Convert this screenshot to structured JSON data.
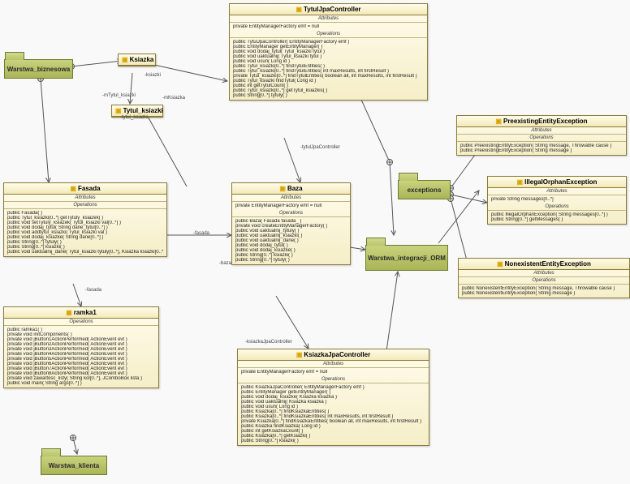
{
  "packages": {
    "warstwa_biznesowa": "Warstwa_biznesowa",
    "exceptions": "exceptions",
    "warstwa_integracji_orm": "Warstwa_integracji_ORM",
    "warstwa_klienta": "Warstwa_klienta"
  },
  "classes": {
    "ksiazka": {
      "title": "Ksiazka"
    },
    "tytul_ksiazki": {
      "title": "Tytul_ksiazki"
    },
    "tytuljpa": {
      "title": "TytulJpaController",
      "attrs_label": "Attributes",
      "attr1": "private EntityManagerFactory emf = null",
      "ops_label": "Operations",
      "ops": [
        "public TytulJpaController( EntityManagerFactory emf )",
        "public EntityManager getEntityManager( )",
        "public void dodaj_tytul( Tytul_ksiazki tytul )",
        "public void uaktualnij( Tytul_ksiazki tytul )",
        "public void usun( Long id )",
        "public Tytul_ksiazki[0..*] findTytulEntities( )",
        "public Tytul_ksiazki[0..*] findTytulEntities( int maxResults, int firstResult )",
        "private Tytul_ksiazki[0..*] findTytulEntities( boolean all, int maxResults, int firstResult )",
        "public Tytul_ksiazki findTytul( Long id )",
        "public int getTytulCount( )",
        "public Tytul_ksiazki[0..*] getTytul_ksiazkis( )",
        "public String[0..*] tytuly( )"
      ]
    },
    "fasada": {
      "title": "Fasada",
      "attrs_label": "Attributes",
      "ops_label": "Operations",
      "ops": [
        "public Fasada( )",
        "public Tytul_ksiazki[0..*] getTytuly_ksiazek( )",
        "public void setTytuly_ksiazek( Tytul_ksiazki val[0..*] )",
        "public void dodaj_tytul( String dane_tytul[0..*] )",
        "public void addtytul_ksiazki( Tytul_ksiazki val )",
        "public void dodaj_ksiazke( String dane[0..*] )",
        "public String[0..*] tytuly( )",
        "public String[0..*] ksiazki( )",
        "public void uaktualnij_dane( Tytul_ksiazki tytuly[0..*], Ksiazka ksiazki[0..*] )"
      ]
    },
    "baza": {
      "title": "Baza",
      "attrs_label": "Attributes",
      "attr1": "private EntityManagerFactory emf = null",
      "ops_label": "Operations",
      "ops": [
        "public Baza( Fasada fasada_ )",
        "private void createEntityManagerFactory( )",
        "public void uaktualnij_tytuly( )",
        "public void uaktualnij_ksiazki( )",
        "public void uaktualnij_dane( )",
        "public void dodaj_tytul( )",
        "public void dodaj_ksiazke( )",
        "public String[0..*] ksiazki( )",
        "public String[0..*] tytuly( )"
      ]
    },
    "ramka1": {
      "title": "ramka1",
      "ops_label": "Operations",
      "ops": [
        "public ramka1( )",
        "private void initComponents( )",
        "private void jButton1ActionPerformed( ActionEvent evt )",
        "private void jButton2ActionPerformed( ActionEvent evt )",
        "private void jButton3ActionPerformed( ActionEvent evt )",
        "private void jButton4ActionPerformed( ActionEvent evt )",
        "private void jButton5ActionPerformed( ActionEvent evt )",
        "private void jButton6ActionPerformed( ActionEvent evt )",
        "private void jButton7ActionPerformed( ActionEvent evt )",
        "private void jButton8ActionPerformed( ActionEvent evt )",
        "private void zawartosc_listy( String kol[0..*], JComboBox lista )",
        "public void main( String args[0..*] )"
      ]
    },
    "ksiazkajpa": {
      "title": "KsiazkaJpaController",
      "attrs_label": "Attributes",
      "attr1": "private EntityManagerFactory emf = null",
      "ops_label": "Operations",
      "ops": [
        "public KsiazkaJpaController( EntityManagerFactory emf )",
        "public EntityManager getEntityManager( )",
        "public void dodaj_ksiazke( Ksiazka ksiazka )",
        "public void uaktualnij( Ksiazka ksiazka )",
        "public void usun( Long id )",
        "public Ksiazka[0..*] findKsiazkaEntities( )",
        "public Ksiazka[0..*] findKsiazkaEntities( int maxResults, int firstResult )",
        "private Ksiazka[0..*] findKsiazkaEntities( boolean all, int maxResults, int firstResult )",
        "public Ksiazka findKsiazka( Long id )",
        "public int getKsiazkaCount( )",
        "public Ksiazka[0..*] getKsiazki( )",
        "public String[0..*] ksiazki( )"
      ]
    },
    "preexisting": {
      "title": "PreexistingEntityException",
      "attrs_label": "Attributes",
      "ops_label": "Operations",
      "ops": [
        "public PreexistingEntityException( String message, Throwable cause )",
        "public PreexistingEntityException( String message )"
      ]
    },
    "illegalorphan": {
      "title": "IllegalOrphanException",
      "attrs_label": "Attributes",
      "attr1": "private String messages[0..*]",
      "ops_label": "Operations",
      "ops": [
        "public IllegalOrphanException( String messages[0..*] )",
        "public String[0..*] getMessages( )"
      ]
    },
    "nonexistent": {
      "title": "NonexistentEntityException",
      "attrs_label": "Attributes",
      "ops_label": "Operations",
      "ops": [
        "public NonexistentEntityException( String message, Throwable cause )",
        "public NonexistentEntityException( String message )"
      ]
    }
  },
  "edge_labels": {
    "ksiazki": "-ksiazki",
    "mtytul_ksiazki": "-mTytul_ksiazki",
    "tytul_ksiazki_col": "-tytul_ksiazki",
    "mksiazka": "-mKsiazka",
    "fasada": "-fasada",
    "baza": "-baza",
    "fasada2": "-fasada",
    "tytuljpactrl": "-tytulJpaController",
    "ksiazkajpactrl": "-ksiazkaJpaController"
  }
}
